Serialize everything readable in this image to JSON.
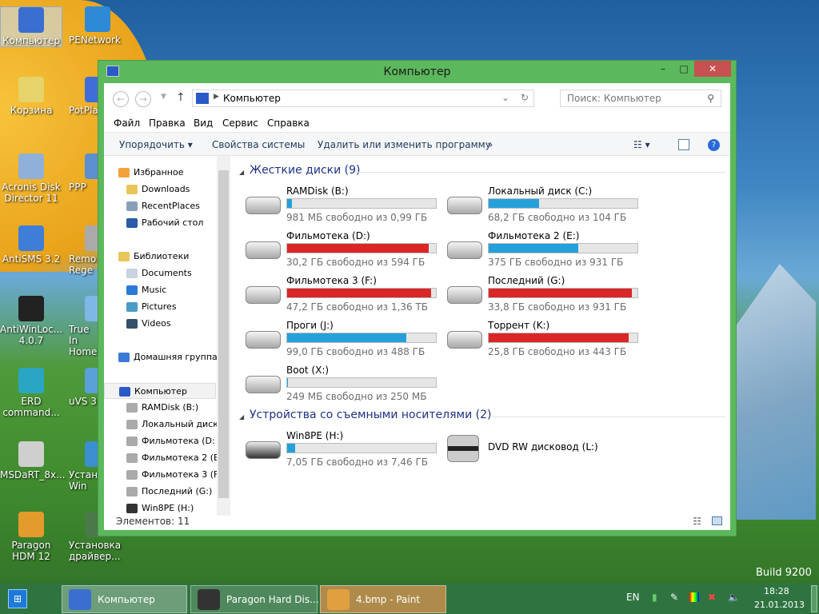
{
  "desktop": {
    "build": "Build 9200",
    "icons": [
      {
        "label": "Компьютер",
        "color": "#3a6fd0",
        "selected": true
      },
      {
        "label": "Корзина",
        "color": "#e6d36a"
      },
      {
        "label": "Acronis Disk Director 11",
        "color": "#8fb0d8"
      },
      {
        "label": "AntiSMS 3.2",
        "color": "#3f7ed8"
      },
      {
        "label": "AntiWinLoc... 4.0.7",
        "color": "#222222"
      },
      {
        "label": "ERD command...",
        "color": "#2aa6c4"
      },
      {
        "label": "MSDaRT_8x...",
        "color": "#cfcfcf"
      },
      {
        "label": "Paragon HDM 12",
        "color": "#e39b2b"
      }
    ],
    "icons2": [
      {
        "label": "PENetwork",
        "color": "#2d8ad6"
      },
      {
        "label": "PotPla",
        "color": "#3e6fd8"
      },
      {
        "label": "PPP",
        "color": "#5a8fd0"
      },
      {
        "label": "Remo Rege",
        "color": "#aaaaaa"
      },
      {
        "label": "True In Home",
        "color": "#7fb7e6"
      },
      {
        "label": "uVS 3",
        "color": "#5aa0d8"
      },
      {
        "label": "Устано Win",
        "color": "#3a8fd0"
      },
      {
        "label": "Установка драйвер...",
        "color": "#4a7a4a"
      }
    ]
  },
  "window": {
    "title": "Компьютер",
    "address": "Компьютер",
    "search_placeholder": "Поиск: Компьютер",
    "menu": [
      "Файл",
      "Правка",
      "Вид",
      "Сервис",
      "Справка"
    ],
    "commands": {
      "organize": "Упорядочить ▾",
      "system_props": "Свойства системы",
      "uninstall": "Удалить или изменить программу",
      "more": "»"
    },
    "sidebar": [
      {
        "label": "Избранное",
        "icon": "star-icon",
        "color": "#f2a23a",
        "level": 0
      },
      {
        "label": "Downloads",
        "icon": "folder-icon",
        "color": "#e8c65a",
        "level": 1
      },
      {
        "label": "RecentPlaces",
        "icon": "recent-places-icon",
        "color": "#8aa0b8",
        "level": 1
      },
      {
        "label": "Рабочий стол",
        "icon": "desktop-icon",
        "color": "#2a5aa8",
        "level": 1
      },
      {
        "label": "",
        "gap": true
      },
      {
        "label": "Библиотеки",
        "icon": "libraries-icon",
        "color": "#e8c65a",
        "level": 0
      },
      {
        "label": "Documents",
        "icon": "document-icon",
        "color": "#c8d4e0",
        "level": 1
      },
      {
        "label": "Music",
        "icon": "music-icon",
        "color": "#2a7ad8",
        "level": 1
      },
      {
        "label": "Pictures",
        "icon": "pictures-icon",
        "color": "#4a9ac8",
        "level": 1
      },
      {
        "label": "Videos",
        "icon": "videos-icon",
        "color": "#35506a",
        "level": 1
      },
      {
        "label": "",
        "gap": true
      },
      {
        "label": "Домашняя группа",
        "icon": "homegroup-icon",
        "color": "#3a7ad8",
        "level": 0
      },
      {
        "label": "",
        "gap": true
      },
      {
        "label": "Компьютер",
        "icon": "computer-icon",
        "color": "#2a5ac8",
        "level": 0,
        "selected": true
      },
      {
        "label": "RAMDisk (B:)",
        "icon": "drive-icon",
        "color": "#aaaaaa",
        "level": 1
      },
      {
        "label": "Локальный диск",
        "icon": "drive-icon",
        "color": "#aaaaaa",
        "level": 1
      },
      {
        "label": "Фильмотека  (D:",
        "icon": "drive-icon",
        "color": "#aaaaaa",
        "level": 1
      },
      {
        "label": "Фильмотека 2 (E",
        "icon": "drive-icon",
        "color": "#aaaaaa",
        "level": 1
      },
      {
        "label": "Фильмотека 3 (F",
        "icon": "drive-icon",
        "color": "#aaaaaa",
        "level": 1
      },
      {
        "label": "Последний (G:)",
        "icon": "drive-icon",
        "color": "#aaaaaa",
        "level": 1
      },
      {
        "label": "Win8PE (H:)",
        "icon": "usb-drive-icon",
        "color": "#333333",
        "level": 1
      }
    ],
    "groups": {
      "hdd": "Жесткие диски (9)",
      "removable": "Устройства со съемными носителями (2)"
    },
    "drives": [
      {
        "name": "RAMDisk (B:)",
        "free": "981 МБ свободно из 0,99 ГБ",
        "used_pct": 3,
        "status": "normal"
      },
      {
        "name": "Локальный диск (C:)",
        "free": "68,2 ГБ свободно из 104 ГБ",
        "used_pct": 34,
        "status": "normal"
      },
      {
        "name": "Фильмотека  (D:)",
        "free": "30,2 ГБ свободно из 594 ГБ",
        "used_pct": 95,
        "status": "low"
      },
      {
        "name": "Фильмотека 2 (E:)",
        "free": "375 ГБ свободно из 931 ГБ",
        "used_pct": 60,
        "status": "normal"
      },
      {
        "name": "Фильмотека 3 (F:)",
        "free": "47,2 ГБ свободно из 1,36 ТБ",
        "used_pct": 97,
        "status": "low"
      },
      {
        "name": "Последний (G:)",
        "free": "33,8 ГБ свободно из 931 ГБ",
        "used_pct": 96,
        "status": "low"
      },
      {
        "name": "Проги (J:)",
        "free": "99,0 ГБ свободно из 488 ГБ",
        "used_pct": 80,
        "status": "normal"
      },
      {
        "name": "Торрент (K:)",
        "free": "25,8 ГБ свободно из 443 ГБ",
        "used_pct": 94,
        "status": "low"
      },
      {
        "name": "Boot (X:)",
        "free": "249 МБ свободно из 250 МБ",
        "used_pct": 0.4,
        "status": "normal"
      }
    ],
    "removable": [
      {
        "name": "Win8PE (H:)",
        "free": "7,05 ГБ свободно из 7,46 ГБ",
        "used_pct": 5.5,
        "status": "normal"
      },
      {
        "name": "DVD RW дисковод (L:)"
      }
    ],
    "status": "Элементов: 11",
    "colors": {
      "normal": "#26a0da",
      "low": "#da2626",
      "frame": "#5cb85c"
    }
  },
  "taskbar": {
    "items": [
      {
        "label": "Компьютер",
        "color": "#3a6fd0"
      },
      {
        "label": "Paragon Hard Dis...",
        "color": "#333333"
      },
      {
        "label": "4.bmp - Paint",
        "color": "#e0a040"
      }
    ],
    "lang": "EN",
    "time": "18:28",
    "date": "21.01.2013"
  }
}
